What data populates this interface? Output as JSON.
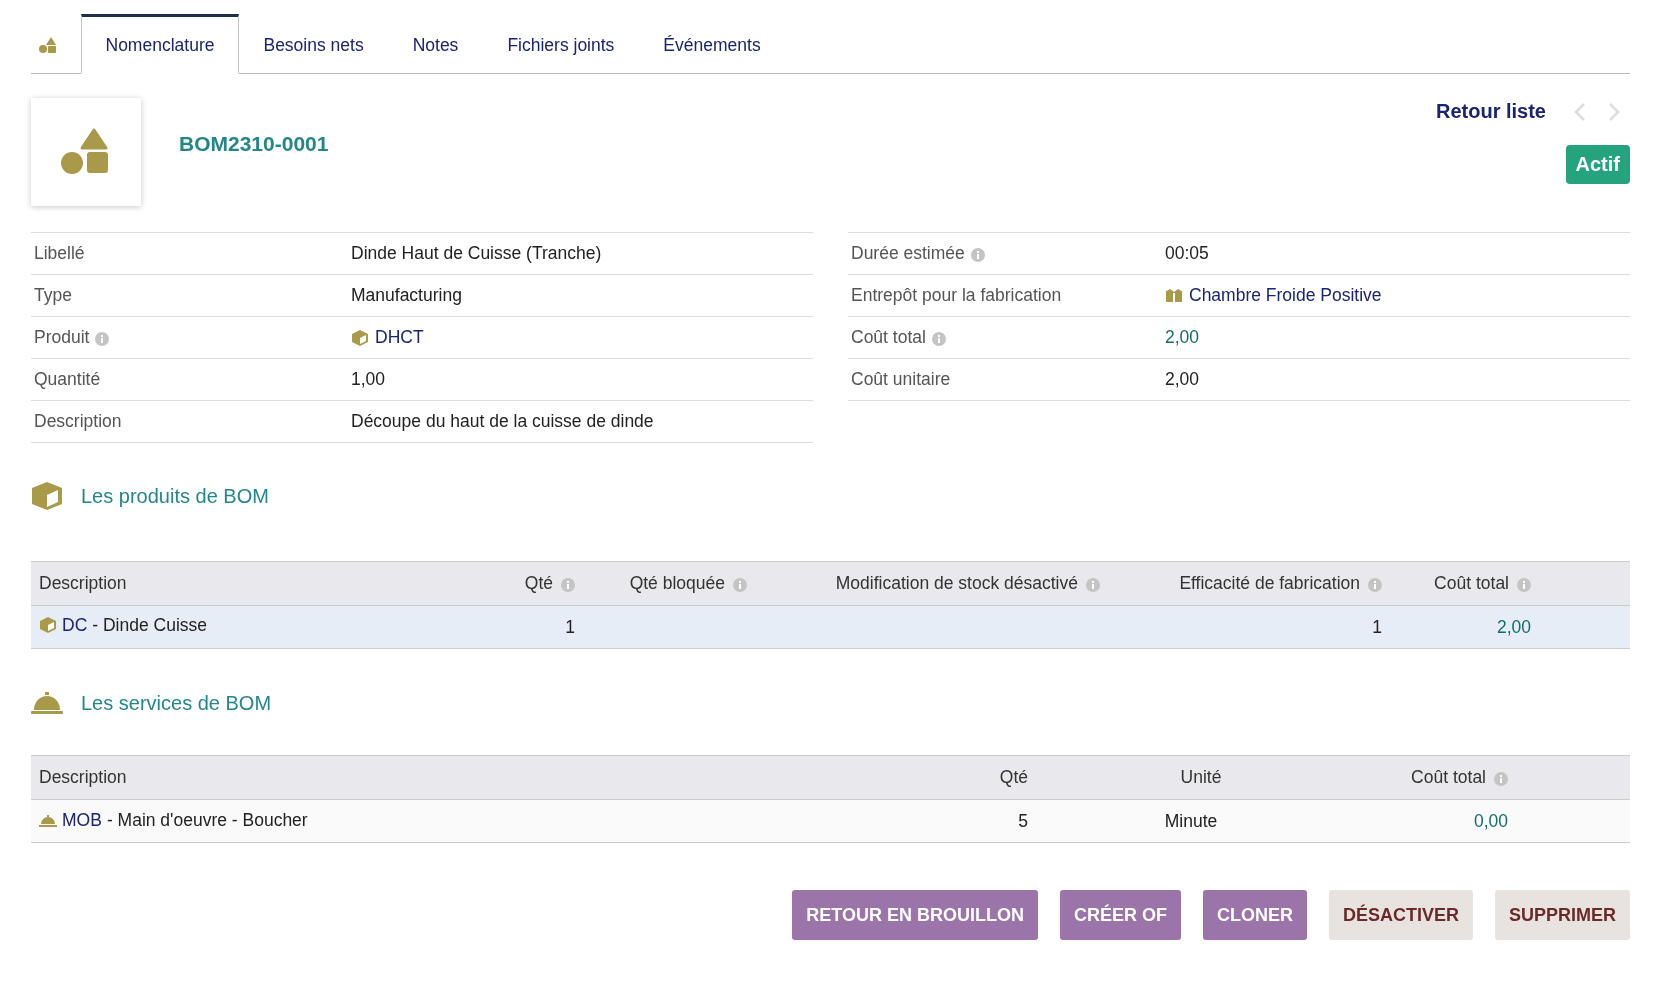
{
  "tabs": [
    {
      "kind": "icon",
      "selected": false
    },
    {
      "kind": "text",
      "label": "Nomenclature",
      "selected": true
    },
    {
      "kind": "text",
      "label": "Besoins nets",
      "selected": false
    },
    {
      "kind": "text",
      "label": "Notes",
      "selected": false
    },
    {
      "kind": "text",
      "label": "Fichiers joints",
      "selected": false
    },
    {
      "kind": "text",
      "label": "Événements",
      "selected": false
    }
  ],
  "header": {
    "ref": "BOM2310-0001",
    "back_link": "Retour liste",
    "previous": {
      "disabled": true
    },
    "next": {
      "disabled": true
    },
    "status": "Actif"
  },
  "fields_left": [
    {
      "label": "Libellé",
      "info": false,
      "kind": "text",
      "value": "Dinde Haut de Cuisse (Tranche)"
    },
    {
      "label": "Type",
      "info": false,
      "kind": "text",
      "value": "Manufacturing"
    },
    {
      "label": "Produit",
      "info": true,
      "kind": "product",
      "value": "DHCT"
    },
    {
      "label": "Quantité",
      "info": false,
      "kind": "text",
      "value": "1,00"
    },
    {
      "label": "Description",
      "info": false,
      "kind": "text",
      "value": "Découpe du haut de la cuisse de dinde"
    }
  ],
  "fields_right": [
    {
      "label": "Durée estimée",
      "info": true,
      "kind": "text",
      "value": "00:05"
    },
    {
      "label": "Entrepôt pour la fabrication",
      "info": false,
      "kind": "warehouse",
      "value": "Chambre Froide Positive"
    },
    {
      "label": "Coût total",
      "info": true,
      "kind": "amount",
      "value": "2,00"
    },
    {
      "label": "Coût unitaire",
      "info": false,
      "kind": "text",
      "value": "2,00"
    }
  ],
  "products": {
    "title": "Les produits de BOM",
    "columns": [
      {
        "label": "Description",
        "info": false
      },
      {
        "label": "Qté",
        "info": true
      },
      {
        "label": "Qté bloquée",
        "info": true
      },
      {
        "label": "Modification de stock désactivé",
        "info": true
      },
      {
        "label": "Efficacité de fabrication",
        "info": true
      },
      {
        "label": "Coût total",
        "info": true
      }
    ],
    "rows": [
      {
        "ref": "DC",
        "name": "- Dinde Cuisse",
        "qty": "1",
        "efficiency": "1",
        "cost": "2,00"
      }
    ]
  },
  "services": {
    "title": "Les services de BOM",
    "columns": [
      {
        "label": "Description",
        "info": false
      },
      {
        "label": "Qté",
        "info": false
      },
      {
        "label": "Unité",
        "info": false
      },
      {
        "label": "Coût total",
        "info": true
      }
    ],
    "rows": [
      {
        "ref": "MOB",
        "name": "- Main d'oeuvre - Boucher",
        "qty": "5",
        "unit": "Minute",
        "cost": "0,00"
      }
    ]
  },
  "actions": [
    {
      "label": "RETOUR EN BROUILLON",
      "kind": "primary"
    },
    {
      "label": "CRÉER OF",
      "kind": "primary"
    },
    {
      "label": "CLONER",
      "kind": "primary"
    },
    {
      "label": "DÉSACTIVER",
      "kind": "secondary"
    },
    {
      "label": "SUPPRIMER",
      "kind": "secondary"
    }
  ]
}
